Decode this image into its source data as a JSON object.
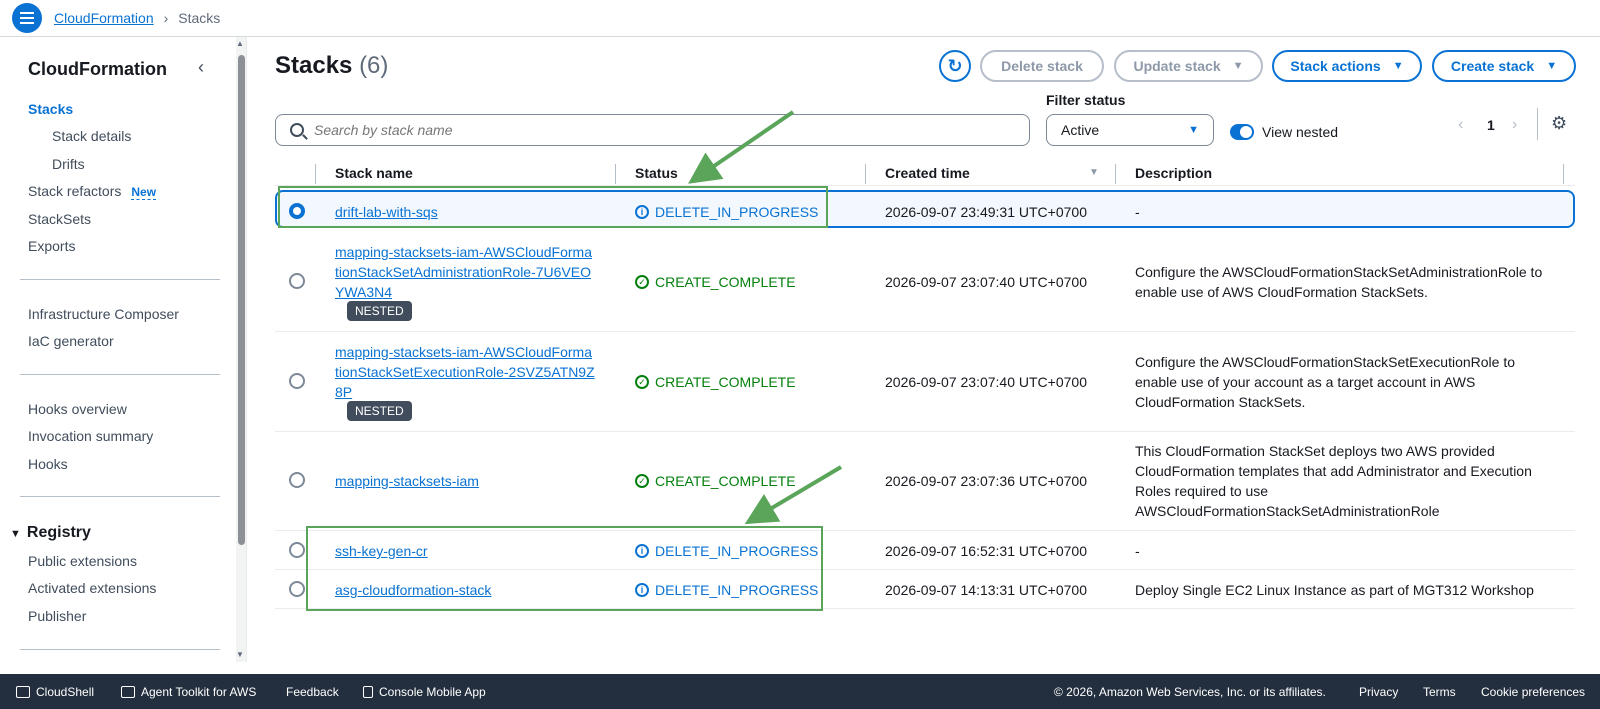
{
  "breadcrumb": {
    "root": "CloudFormation",
    "current": "Stacks"
  },
  "sidebar": {
    "title": "CloudFormation",
    "items": [
      {
        "label": "Stacks"
      },
      {
        "label": "Stack details"
      },
      {
        "label": "Drifts"
      },
      {
        "label": "Stack refactors",
        "badge": "New"
      },
      {
        "label": "StackSets"
      },
      {
        "label": "Exports"
      },
      {
        "label": "Infrastructure Composer"
      },
      {
        "label": "IaC generator"
      },
      {
        "label": "Hooks overview"
      },
      {
        "label": "Invocation summary"
      },
      {
        "label": "Hooks"
      }
    ],
    "registry": {
      "title": "Registry",
      "items": [
        {
          "label": "Public extensions"
        },
        {
          "label": "Activated extensions"
        },
        {
          "label": "Publisher"
        }
      ]
    }
  },
  "main": {
    "title": "Stacks",
    "count": "(6)",
    "buttons": {
      "delete": "Delete stack",
      "update": "Update stack",
      "actions": "Stack actions",
      "create": "Create stack"
    },
    "search_placeholder": "Search by stack name",
    "filter": {
      "label": "Filter status",
      "value": "Active"
    },
    "view_nested": "View nested",
    "page": "1"
  },
  "table": {
    "columns": [
      "Stack name",
      "Status",
      "Created time",
      "Description"
    ],
    "rows": [
      {
        "name": "drift-lab-with-sqs",
        "status": "DELETE_IN_PROGRESS",
        "created": "2026-09-07 23:49:31 UTC+0700",
        "description": "-",
        "selected": true
      },
      {
        "name": "mapping-stacksets-iam-AWSCloudFormationStackSetAdministrationRole-7U6VEOYWA3N4",
        "nested": "NESTED",
        "status": "CREATE_COMPLETE",
        "created": "2026-09-07 23:07:40 UTC+0700",
        "description": "Configure the AWSCloudFormationStackSetAdministrationRole to enable use of AWS CloudFormation StackSets."
      },
      {
        "name": "mapping-stacksets-iam-AWSCloudFormationStackSetExecutionRole-2SVZ5ATN9Z8P",
        "nested": "NESTED",
        "status": "CREATE_COMPLETE",
        "created": "2026-09-07 23:07:40 UTC+0700",
        "description": "Configure the AWSCloudFormationStackSetExecutionRole to enable use of your account as a target account in AWS CloudFormation StackSets."
      },
      {
        "name": "mapping-stacksets-iam",
        "status": "CREATE_COMPLETE",
        "created": "2026-09-07 23:07:36 UTC+0700",
        "description": "This CloudFormation StackSet deploys two AWS provided CloudFormation templates that add Administrator and Execution Roles required to use AWSCloudFormationStackSetAdministrationRole"
      },
      {
        "name": "ssh-key-gen-cr",
        "status": "DELETE_IN_PROGRESS",
        "created": "2026-09-07 16:52:31 UTC+0700",
        "description": "-"
      },
      {
        "name": "asg-cloudformation-stack",
        "status": "DELETE_IN_PROGRESS",
        "created": "2026-09-07 14:13:31 UTC+0700",
        "description": "Deploy Single EC2 Linux Instance as part of MGT312 Workshop"
      }
    ]
  },
  "footer": {
    "cloudshell": "CloudShell",
    "agent_toolkit": "Agent Toolkit for AWS",
    "feedback": "Feedback",
    "mobile_app": "Console Mobile App",
    "copyright": "© 2026, Amazon Web Services, Inc. or its affiliates.",
    "privacy": "Privacy",
    "terms": "Terms",
    "cookies": "Cookie preferences"
  },
  "colors": {
    "accent": "#0972d3",
    "success": "#037f0c",
    "annotation": "#5aa55a",
    "footer_bg": "#232f3e"
  }
}
